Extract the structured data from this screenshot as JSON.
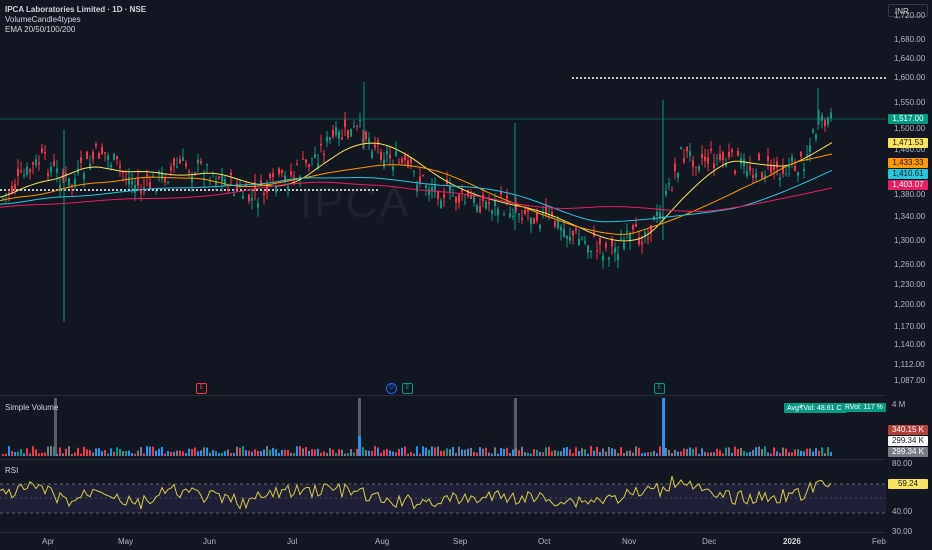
{
  "legend": {
    "title": "IPCA Laboratories Limited · 1D · NSE",
    "indicator1": "VolumeCandle4types",
    "indicator2": "EMA 20/50/100/200"
  },
  "watermark": "IPCA",
  "currency_button": "INR",
  "price_axis": [
    "1,720.00",
    "1,680.00",
    "1,640.00",
    "1,600.00",
    "1,550.00",
    "1,500.00",
    "1,460.00",
    "1,380.00",
    "1,340.00",
    "1,300.00",
    "1,260.00",
    "1,230.00",
    "1,200.00",
    "1,170.00",
    "1,140.00",
    "1,112.00",
    "1,087.00"
  ],
  "price_tags": {
    "last": "1,517.00",
    "ema20": "1,471.53",
    "ema50": "1,433.33",
    "ema100": "1,410.61",
    "ema200": "1,403.07"
  },
  "events": [
    {
      "label": "E",
      "color": "#f23645"
    },
    {
      "label": "D",
      "color": "#2962ff"
    },
    {
      "label": "E",
      "color": "#089981"
    },
    {
      "label": "E",
      "color": "#089981"
    }
  ],
  "volume_pane": {
    "label": "Simple Volume",
    "avg_badge": "Avg₹Vol: 48.61 Cr",
    "rvol_badge": "RVol: 117 %",
    "axis_top": "4 M",
    "tags": [
      "340.15 K",
      "299.34 K",
      "299.34 K"
    ]
  },
  "rsi_pane": {
    "label": "RSI",
    "axis": [
      "80.00",
      "40.00",
      "30.00"
    ],
    "value_tag": "59.24"
  },
  "time_axis": [
    "Apr",
    "May",
    "Jun",
    "Jul",
    "Aug",
    "Sep",
    "Oct",
    "Nov",
    "Dec",
    "2026",
    "Feb"
  ],
  "colors": {
    "background": "#131722",
    "up": "#089981",
    "down": "#f23645",
    "ema20": "#f7e35d",
    "ema50": "#ff9800",
    "ema100": "#26c6da",
    "ema200": "#e91e63",
    "rsi": "#d6cc4c",
    "volume_blue": "#2196f3"
  }
}
